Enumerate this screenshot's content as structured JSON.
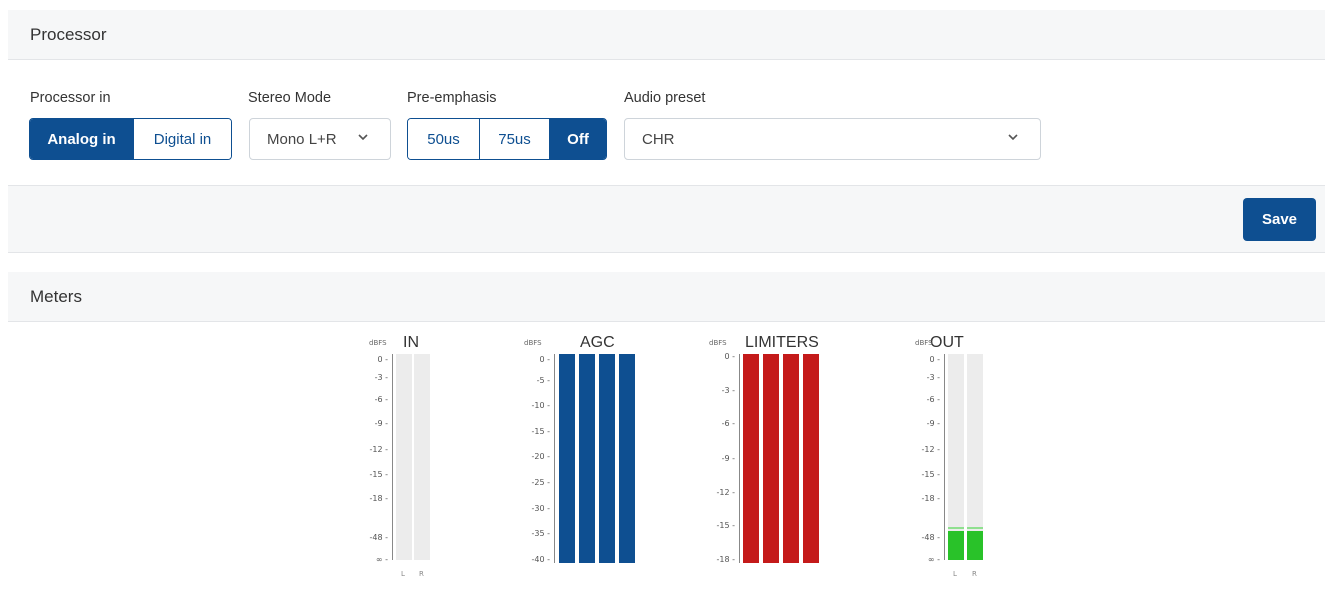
{
  "processor": {
    "title": "Processor",
    "processor_in": {
      "label": "Processor in",
      "options": [
        "Analog in",
        "Digital in"
      ],
      "selected": "Analog in"
    },
    "stereo_mode": {
      "label": "Stereo Mode",
      "value": "Mono L+R"
    },
    "pre_emphasis": {
      "label": "Pre-emphasis",
      "options": [
        "50us",
        "75us",
        "Off"
      ],
      "selected": "Off"
    },
    "audio_preset": {
      "label": "Audio preset",
      "value": "CHR"
    },
    "save_label": "Save"
  },
  "meters": {
    "title": "Meters",
    "unit": "dBFS",
    "groups": [
      {
        "name": "IN",
        "ticks": [
          "0",
          "-3",
          "-6",
          "-9",
          "-12",
          "-15",
          "-18",
          "-48",
          "∞"
        ],
        "channels": [
          "L",
          "R"
        ],
        "color": "#e8e8e8",
        "levels": [
          0,
          0
        ]
      },
      {
        "name": "AGC",
        "ticks": [
          "0",
          "-5",
          "-10",
          "-15",
          "-20",
          "-25",
          "-30",
          "-35",
          "-40"
        ],
        "channels": [
          "",
          "",
          "",
          ""
        ],
        "color": "#0e4f91",
        "levels": [
          1,
          1,
          1,
          1
        ]
      },
      {
        "name": "LIMITERS",
        "ticks": [
          "0",
          "-3",
          "-6",
          "-9",
          "-12",
          "-15",
          "-18"
        ],
        "channels": [
          "",
          "",
          "",
          ""
        ],
        "color": "#c41a1a",
        "levels": [
          1,
          1,
          1,
          1
        ]
      },
      {
        "name": "OUT",
        "ticks": [
          "0",
          "-3",
          "-6",
          "-9",
          "-12",
          "-15",
          "-18",
          "-48",
          "∞"
        ],
        "channels": [
          "L",
          "R"
        ],
        "color": "#29c229",
        "levels": [
          0.14,
          0.14
        ]
      }
    ]
  },
  "colors": {
    "accent": "#0e4f91",
    "panel_bg": "#f6f7f8"
  }
}
